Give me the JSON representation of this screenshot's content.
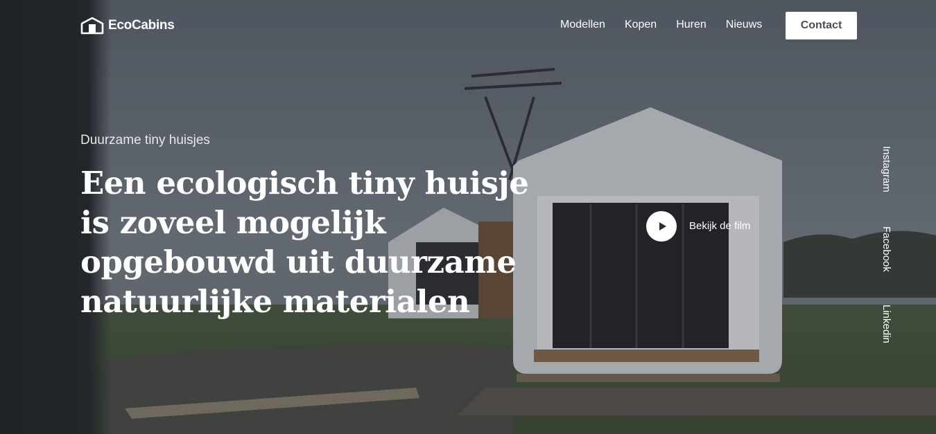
{
  "header": {
    "logo_text": "EcoCabins",
    "nav": [
      "Modellen",
      "Kopen",
      "Huren",
      "Nieuws"
    ],
    "contact_label": "Contact"
  },
  "hero": {
    "eyebrow": "Duurzame tiny huisjes",
    "headline": [
      "Een ecologisch tiny huisje",
      "is zoveel mogelijk",
      "opgebouwd uit duurzame",
      "natuurlijke materialen"
    ],
    "video_label": "Bekijk de film"
  },
  "socials": [
    "Instagram",
    "Facebook",
    "Linkedin"
  ],
  "colors": {
    "overlay": "#2c3036",
    "button_bg": "#ffffff",
    "button_text": "#4b4f55"
  },
  "icons": {
    "logo": "house-icon",
    "play": "play-icon"
  }
}
